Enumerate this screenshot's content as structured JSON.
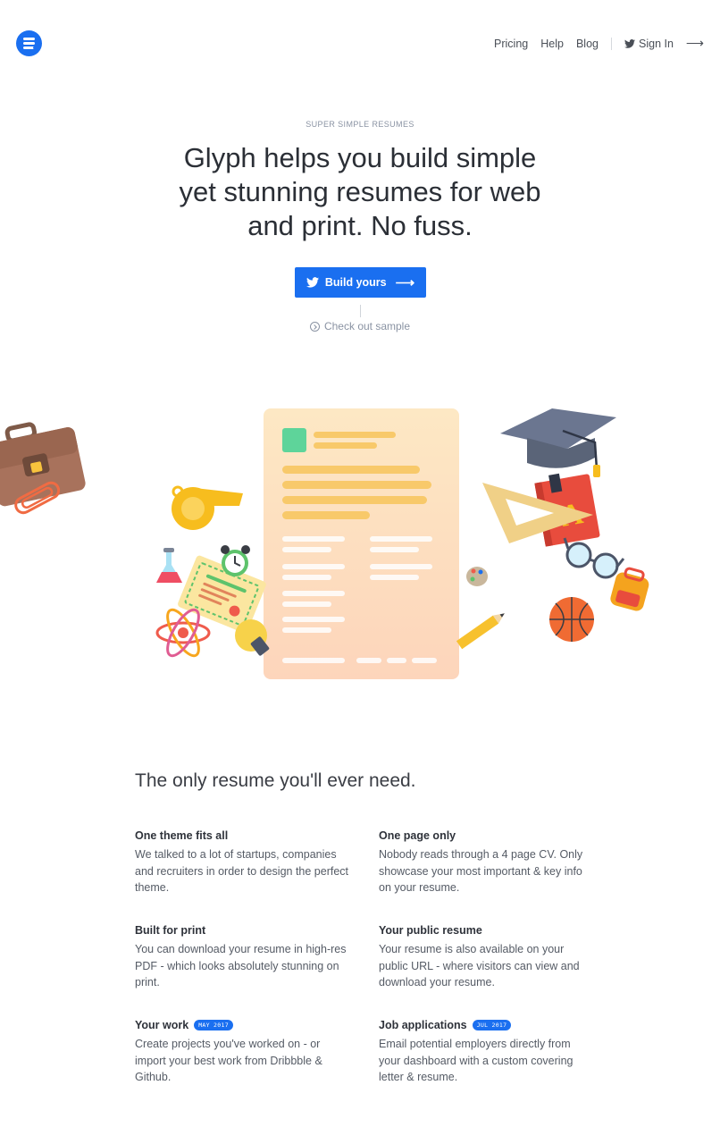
{
  "header": {
    "nav": [
      "Pricing",
      "Help",
      "Blog"
    ],
    "sign_in": "Sign In"
  },
  "hero": {
    "eyebrow": "SUPER SIMPLE RESUMES",
    "headline_lines": [
      "Glyph helps you build simple",
      "yet stunning resumes for web",
      "and print. No fuss."
    ],
    "cta_label": "Build yours",
    "sample_link": "Check out sample"
  },
  "features": {
    "title": "The only resume you'll ever need.",
    "items": [
      {
        "title": "One theme fits all",
        "text": "We talked to a lot of startups, companies and recruiters in order to design the perfect theme.",
        "badge": ""
      },
      {
        "title": "One page only",
        "text": "Nobody reads through a 4 page CV. Only showcase your most important & key info on your resume.",
        "badge": ""
      },
      {
        "title": "Built for print",
        "text": "You can download your resume in high-res PDF - which looks absolutely stunning on print.",
        "badge": ""
      },
      {
        "title": "Your public resume",
        "text": "Your resume is also available on your public URL - where visitors can view and download your resume.",
        "badge": ""
      },
      {
        "title": "Your work",
        "text": "Create projects you've worked on - or import your best work from Dribbble & Github.",
        "badge": "MAY 2017"
      },
      {
        "title": "Job applications",
        "text": "Email potential employers directly from your dashboard with a custom covering letter & resume.",
        "badge": "JUL 2017"
      }
    ]
  },
  "colors": {
    "accent": "#1a6ff0"
  },
  "icons": [
    "logo-icon",
    "twitter-icon",
    "arrow-right-icon",
    "sample-icon"
  ]
}
